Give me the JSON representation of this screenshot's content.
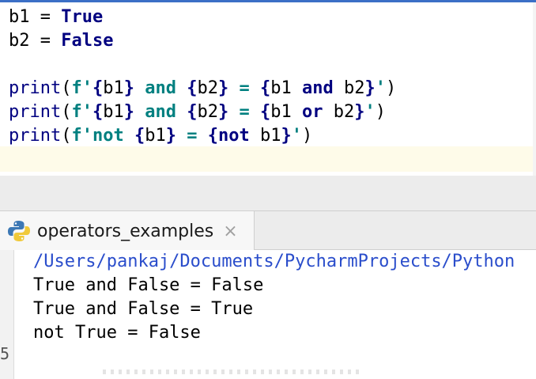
{
  "editor": {
    "lines": [
      [
        {
          "t": "b1 = ",
          "c": ""
        },
        {
          "t": "True",
          "c": "kw"
        }
      ],
      [
        {
          "t": "b2 = ",
          "c": ""
        },
        {
          "t": "False",
          "c": "kw"
        }
      ],
      [],
      [
        {
          "t": "print",
          "c": "fn"
        },
        {
          "t": "(",
          "c": ""
        },
        {
          "t": "f'",
          "c": "str"
        },
        {
          "t": "{",
          "c": "brace"
        },
        {
          "t": "b1",
          "c": ""
        },
        {
          "t": "}",
          "c": "brace"
        },
        {
          "t": " and ",
          "c": "str"
        },
        {
          "t": "{",
          "c": "brace"
        },
        {
          "t": "b2",
          "c": ""
        },
        {
          "t": "}",
          "c": "brace"
        },
        {
          "t": " = ",
          "c": "str"
        },
        {
          "t": "{",
          "c": "brace"
        },
        {
          "t": "b1 ",
          "c": ""
        },
        {
          "t": "and",
          "c": "kw"
        },
        {
          "t": " b2",
          "c": ""
        },
        {
          "t": "}",
          "c": "brace"
        },
        {
          "t": "'",
          "c": "str"
        },
        {
          "t": ")",
          "c": ""
        }
      ],
      [
        {
          "t": "print",
          "c": "fn"
        },
        {
          "t": "(",
          "c": ""
        },
        {
          "t": "f'",
          "c": "str"
        },
        {
          "t": "{",
          "c": "brace"
        },
        {
          "t": "b1",
          "c": ""
        },
        {
          "t": "}",
          "c": "brace"
        },
        {
          "t": " and ",
          "c": "str"
        },
        {
          "t": "{",
          "c": "brace"
        },
        {
          "t": "b2",
          "c": ""
        },
        {
          "t": "}",
          "c": "brace"
        },
        {
          "t": " = ",
          "c": "str"
        },
        {
          "t": "{",
          "c": "brace"
        },
        {
          "t": "b1 ",
          "c": ""
        },
        {
          "t": "or",
          "c": "kw"
        },
        {
          "t": " b2",
          "c": ""
        },
        {
          "t": "}",
          "c": "brace"
        },
        {
          "t": "'",
          "c": "str"
        },
        {
          "t": ")",
          "c": ""
        }
      ],
      [
        {
          "t": "print",
          "c": "fn"
        },
        {
          "t": "(",
          "c": ""
        },
        {
          "t": "f'not ",
          "c": "str"
        },
        {
          "t": "{",
          "c": "brace"
        },
        {
          "t": "b1",
          "c": ""
        },
        {
          "t": "}",
          "c": "brace"
        },
        {
          "t": " = ",
          "c": "str"
        },
        {
          "t": "{",
          "c": "brace"
        },
        {
          "t": "not",
          "c": "kw"
        },
        {
          "t": " b1",
          "c": ""
        },
        {
          "t": "}",
          "c": "brace"
        },
        {
          "t": "'",
          "c": "str"
        },
        {
          "t": ")",
          "c": ""
        }
      ]
    ]
  },
  "run_tab": {
    "icon": "python-icon",
    "label": "operators_examples",
    "close_glyph": "×"
  },
  "console": {
    "lines": [
      "/Users/pankaj/Documents/PycharmProjects/Python",
      "True and False = False",
      "True and False = True",
      "not True = False"
    ],
    "gutter_glyph": "5"
  },
  "colors": {
    "keyword": "#000080",
    "fstring": "#008080",
    "path": "#2a4dcb",
    "current_line": "#fefbe9"
  }
}
